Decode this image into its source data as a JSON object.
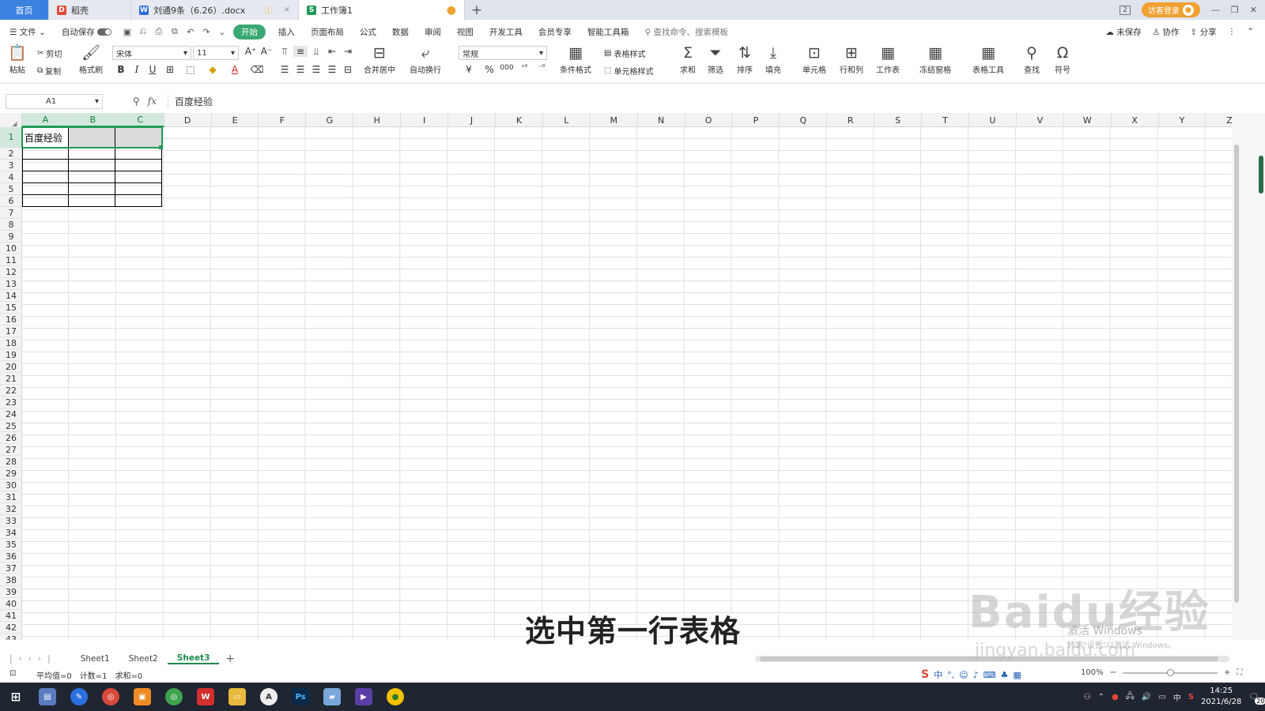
{
  "titlebar": {
    "home_tab": "首页",
    "tabs": [
      {
        "label": "稻壳",
        "icon": "daoke-icon"
      },
      {
        "label": "刘通9条（6.26）.docx",
        "icon": "word-doc-icon"
      },
      {
        "label": "工作簿1",
        "icon": "spreadsheet-icon"
      }
    ],
    "login_label": "访客登录"
  },
  "menubar": {
    "file": "文件",
    "autosave": "自动保存",
    "tabs": [
      "开始",
      "插入",
      "页面布局",
      "公式",
      "数据",
      "审阅",
      "视图",
      "开发工具",
      "会员专享",
      "智能工具箱"
    ],
    "active_tab": "开始",
    "search_placeholder": "查找命令、搜索模板",
    "unsaved": "未保存",
    "collab": "协作",
    "share": "分享"
  },
  "ribbon": {
    "paste": "粘贴",
    "cut": "剪切",
    "copy": "复制",
    "format_painter": "格式刷",
    "font_name": "宋体",
    "font_size": "11",
    "merge_center": "合并居中",
    "wrap_text": "自动换行",
    "number_format": "常规",
    "conditional_format": "条件格式",
    "table_style": "表格样式",
    "cell_style": "单元格样式",
    "sum": "求和",
    "filter": "筛选",
    "sort": "排序",
    "fill": "填充",
    "cells": "单元格",
    "row_col": "行和列",
    "worksheet": "工作表",
    "freeze": "冻结窗格",
    "table_tools": "表格工具",
    "find": "查找",
    "symbol": "符号"
  },
  "formulabar": {
    "name_box": "A1",
    "fx": "fx",
    "content": "百度经验"
  },
  "grid": {
    "columns": [
      "A",
      "B",
      "C",
      "D",
      "E",
      "F",
      "G",
      "H",
      "I",
      "J",
      "K",
      "L",
      "M",
      "N",
      "O",
      "P",
      "Q",
      "R",
      "S",
      "T",
      "U",
      "V",
      "W",
      "X",
      "Y",
      "Z"
    ],
    "rows": [
      "1",
      "2",
      "3",
      "4",
      "5",
      "6",
      "7",
      "8",
      "9",
      "10",
      "11",
      "12",
      "13",
      "14",
      "15",
      "16",
      "17",
      "18",
      "19",
      "20",
      "21",
      "22",
      "23",
      "24",
      "25",
      "26",
      "27",
      "28",
      "29",
      "30",
      "31",
      "32",
      "33",
      "34",
      "35",
      "36",
      "37",
      "38",
      "39",
      "40",
      "41",
      "42",
      "43"
    ],
    "cell_a1": "百度经验",
    "selected_range": "A1:C1"
  },
  "sheets": {
    "tabs": [
      "Sheet1",
      "Sheet2",
      "Sheet3"
    ],
    "active": "Sheet3"
  },
  "statusbar": {
    "average": "平均值=0",
    "count": "计数=1",
    "sum": "求和=0",
    "zoom": "100%"
  },
  "taskbar": {
    "time": "14:25",
    "date": "2021/6/28",
    "lang": "中",
    "notifications": "20"
  },
  "overlay": {
    "subtitle": "选中第一行表格",
    "watermark_logo": "Baidu经验",
    "watermark_url": "jingyan.baidu.com",
    "activate_title": "激活 Windows",
    "activate_sub": "转到\"设置\"以激活 Windows。"
  },
  "colors": {
    "accent_green": "#219a55",
    "tab_blue": "#3b82e0",
    "login_orange": "#f0a030",
    "taskbar_bg": "#1f2531"
  }
}
